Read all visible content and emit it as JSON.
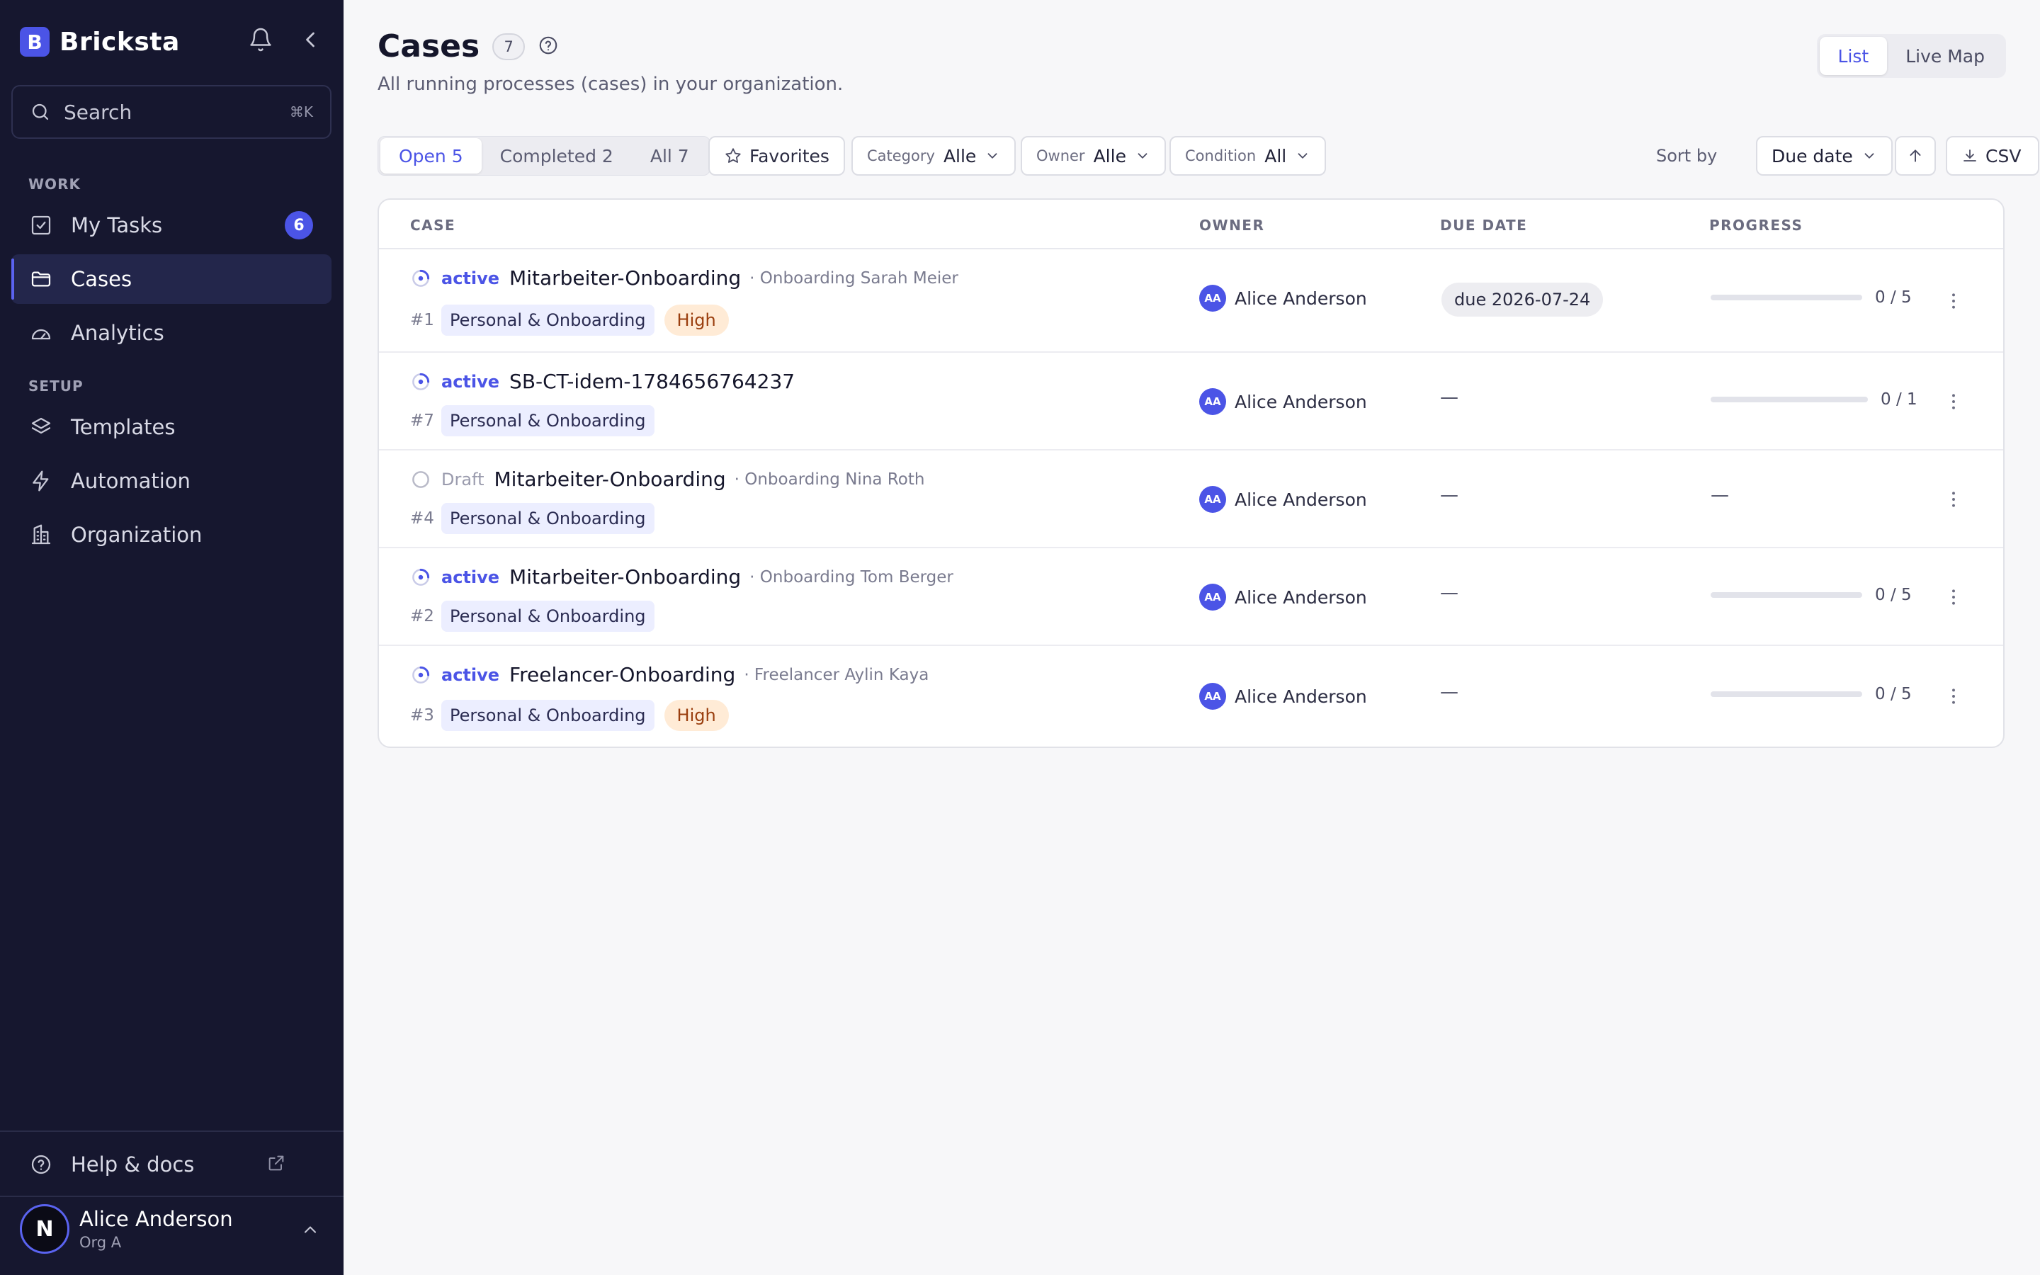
{
  "sidebar": {
    "brand": {
      "logo_letter": "B",
      "name": "Bricksta"
    },
    "search": {
      "placeholder": "Search",
      "shortcut": "⌘K"
    },
    "sections": {
      "work": "WORK",
      "setup": "SETUP"
    },
    "items": [
      {
        "label": "My Tasks",
        "icon": "check-square-icon",
        "badge": "6"
      },
      {
        "label": "Cases",
        "icon": "folder-icon",
        "active": true
      },
      {
        "label": "Analytics",
        "icon": "gauge-icon"
      },
      {
        "label": "Templates",
        "icon": "layers-icon"
      },
      {
        "label": "Automation",
        "icon": "bolt-icon"
      },
      {
        "label": "Organization",
        "icon": "building-icon"
      }
    ],
    "help": {
      "label": "Help & docs",
      "icon": "help-circle-icon"
    },
    "user": {
      "initial": "N",
      "name": "Alice Anderson",
      "org": "Org A"
    }
  },
  "header": {
    "title": "Cases",
    "count": "7",
    "subtitle": "All running processes (cases) in your organization.",
    "views": [
      "List",
      "Live Map"
    ],
    "active_view": "List"
  },
  "filters": {
    "segments": [
      "Open 5",
      "Completed 2",
      "All 7"
    ],
    "active_segment": "Open 5",
    "favorites": "Favorites",
    "category": {
      "label": "Category",
      "value": "Alle"
    },
    "owner": {
      "label": "Owner",
      "value": "Alle"
    },
    "condition": {
      "label": "Condition",
      "value": "All"
    },
    "sort_label": "Sort by",
    "sort_value": "Due date",
    "csv": "CSV"
  },
  "table": {
    "columns": [
      "CASE",
      "OWNER",
      "DUE DATE",
      "PROGRESS"
    ],
    "rows": [
      {
        "status": "active",
        "name": "Mitarbeiter-Onboarding",
        "meta": "· Onboarding Sarah Meier",
        "num": "#1",
        "tag": "Personal & Onboarding",
        "priority": "High",
        "owner_initials": "AA",
        "owner": "Alice Anderson",
        "due": "due 2026-07-24",
        "progress": "0 / 5",
        "progress_fraction": 0
      },
      {
        "status": "active",
        "name": "SB-CT-idem-1784656764237",
        "meta": "",
        "num": "#7",
        "tag": "Personal & Onboarding",
        "priority": "",
        "owner_initials": "AA",
        "owner": "Alice Anderson",
        "due": "—",
        "progress": "0 / 1",
        "progress_fraction": 0
      },
      {
        "status": "Draft",
        "name": "Mitarbeiter-Onboarding",
        "meta": "· Onboarding Nina Roth",
        "num": "#4",
        "tag": "Personal & Onboarding",
        "priority": "",
        "owner_initials": "AA",
        "owner": "Alice Anderson",
        "due": "—",
        "progress": "—",
        "progress_fraction": null
      },
      {
        "status": "active",
        "name": "Mitarbeiter-Onboarding",
        "meta": "· Onboarding Tom Berger",
        "num": "#2",
        "tag": "Personal & Onboarding",
        "priority": "",
        "owner_initials": "AA",
        "owner": "Alice Anderson",
        "due": "—",
        "progress": "0 / 5",
        "progress_fraction": 0
      },
      {
        "status": "active",
        "name": "Freelancer-Onboarding",
        "meta": "· Freelancer Aylin Kaya",
        "num": "#3",
        "tag": "Personal & Onboarding",
        "priority": "High",
        "owner_initials": "AA",
        "owner": "Alice Anderson",
        "due": "—",
        "progress": "0 / 5",
        "progress_fraction": 0
      }
    ]
  },
  "colors": {
    "accent": "#4b54e6",
    "sidebar": "#16172f",
    "priority_bg": "#ffebd6"
  }
}
